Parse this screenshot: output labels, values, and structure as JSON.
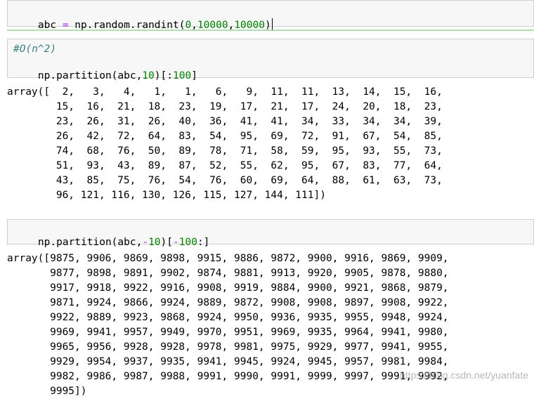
{
  "cells": [
    {
      "code": "abc = np.random.randint(0,10000,10000)",
      "tokens": [
        {
          "t": "abc ",
          "c": ""
        },
        {
          "t": "=",
          "c": "op"
        },
        {
          "t": " np.random.randint(",
          "c": ""
        },
        {
          "t": "0",
          "c": "num"
        },
        {
          "t": ",",
          "c": ""
        },
        {
          "t": "10000",
          "c": "num"
        },
        {
          "t": ",",
          "c": ""
        },
        {
          "t": "10000",
          "c": "num"
        },
        {
          "t": ")",
          "c": ""
        }
      ]
    },
    {
      "comment": "#O(n^2)",
      "tokens": [
        {
          "t": "np.partition(abc,",
          "c": ""
        },
        {
          "t": "10",
          "c": "num"
        },
        {
          "t": ")[:",
          "c": ""
        },
        {
          "t": "100",
          "c": "num"
        },
        {
          "t": "]",
          "c": ""
        }
      ]
    },
    {
      "tokens": [
        {
          "t": "np.partition(abc,",
          "c": ""
        },
        {
          "t": "-",
          "c": "op"
        },
        {
          "t": "10",
          "c": "num"
        },
        {
          "t": ")[",
          "c": ""
        },
        {
          "t": "-",
          "c": "op"
        },
        {
          "t": "100",
          "c": "num"
        },
        {
          "t": ":]",
          "c": ""
        }
      ]
    }
  ],
  "outputs": [
    {
      "lines": [
        "array([  2,   3,   4,   1,   1,   6,   9,  11,  11,  13,  14,  15,  16,",
        "        15,  16,  21,  18,  23,  19,  17,  21,  17,  24,  20,  18,  23,",
        "        23,  26,  31,  26,  40,  36,  41,  41,  34,  33,  34,  34,  39,",
        "        26,  42,  72,  64,  83,  54,  95,  69,  72,  91,  67,  54,  85,",
        "        74,  68,  76,  50,  89,  78,  71,  58,  59,  95,  93,  55,  73,",
        "        51,  93,  43,  89,  87,  52,  55,  62,  95,  67,  83,  77,  64,",
        "        43,  85,  75,  76,  54,  76,  60,  69,  64,  88,  61,  63,  73,",
        "        96, 121, 116, 130, 126, 115, 127, 144, 111])"
      ]
    },
    {
      "lines": [
        "array([9875, 9906, 9869, 9898, 9915, 9886, 9872, 9900, 9916, 9869, 9909,",
        "       9877, 9898, 9891, 9902, 9874, 9881, 9913, 9920, 9905, 9878, 9880,",
        "       9917, 9918, 9922, 9916, 9908, 9919, 9884, 9900, 9921, 9868, 9879,",
        "       9871, 9924, 9866, 9924, 9889, 9872, 9908, 9908, 9897, 9908, 9922,",
        "       9922, 9889, 9923, 9868, 9924, 9950, 9936, 9935, 9955, 9948, 9924,",
        "       9969, 9941, 9957, 9949, 9970, 9951, 9969, 9935, 9964, 9941, 9980,",
        "       9965, 9956, 9928, 9928, 9978, 9981, 9975, 9929, 9977, 9941, 9955,",
        "       9929, 9954, 9937, 9935, 9941, 9945, 9924, 9945, 9957, 9981, 9984,",
        "       9982, 9986, 9987, 9988, 9991, 9990, 9991, 9999, 9997, 9991, 9992,",
        "       9995])"
      ]
    }
  ],
  "watermark": "https://blog.csdn.net/yuanfate"
}
